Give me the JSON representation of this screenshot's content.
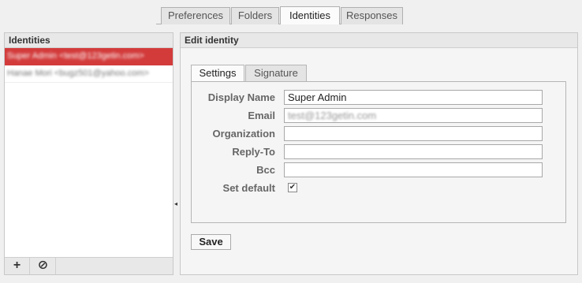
{
  "top_tabs": [
    "Preferences",
    "Folders",
    "Identities",
    "Responses"
  ],
  "left_panel": {
    "title": "Identities",
    "items": [
      {
        "text": "Super Admin <test@123getin.com>"
      },
      {
        "text": "Hanae Mori <bugz501@yahoo.com>"
      }
    ],
    "footer": {
      "add_icon": "+",
      "delete_icon": "⊘"
    }
  },
  "right_panel": {
    "title": "Edit identity",
    "tabs": [
      "Settings",
      "Signature"
    ],
    "form": {
      "display_name": {
        "label": "Display Name",
        "value": "Super Admin"
      },
      "email": {
        "label": "Email",
        "value": "test@123getin.com"
      },
      "organization": {
        "label": "Organization",
        "value": ""
      },
      "reply_to": {
        "label": "Reply-To",
        "value": ""
      },
      "bcc": {
        "label": "Bcc",
        "value": ""
      },
      "set_default": {
        "label": "Set default",
        "checked": true,
        "mark": "✔"
      }
    },
    "save_label": "Save"
  },
  "colors": {
    "selected": "#d33b3b"
  }
}
